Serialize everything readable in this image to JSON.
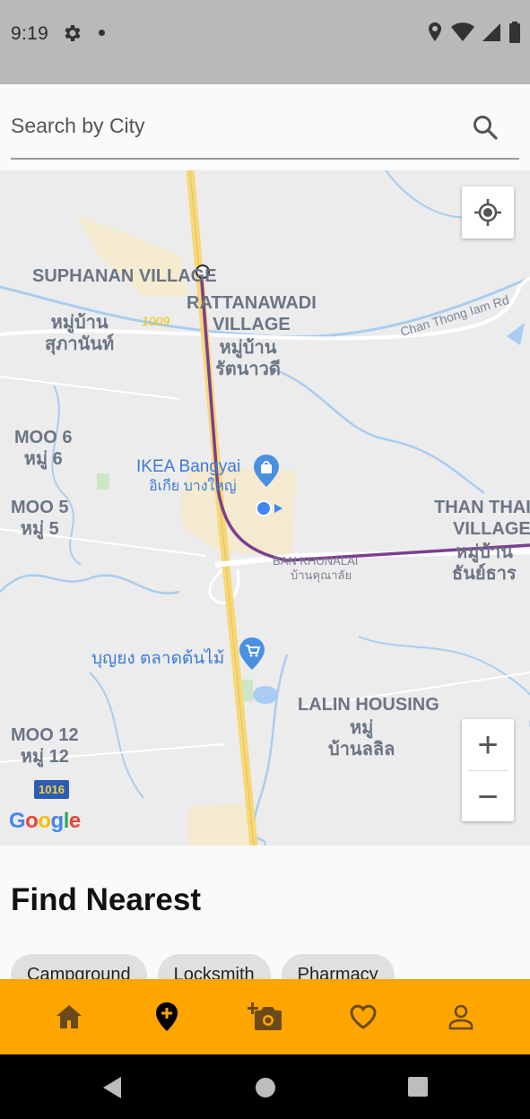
{
  "status_bar": {
    "time": "9:19",
    "icons": [
      "gear-icon",
      "dot-icon",
      "location-icon",
      "wifi-icon",
      "signal-icon",
      "battery-icon"
    ]
  },
  "search": {
    "placeholder": "Search by City",
    "icon": "search-icon"
  },
  "map": {
    "places": {
      "suphanan_en": "SUPHANAN\nVILLAGE",
      "suphanan_th": "หมู่บ้าน\nสุภานันท์",
      "rattanawadi_en": "RATTANAWADI\nVILLAGE",
      "rattanawadi_th": "หมู่บ้าน\nรัตนาวดี",
      "moo6": "MOO 6\nหมู่ 6",
      "moo5": "MOO 5\nหมู่ 5",
      "moo12": "MOO 12\nหมู่ 12",
      "ikea_en": "IKEA Bangyai",
      "ikea_th": "อิเกีย บางใหญ่",
      "than_thai_en": "THAN THAI\nVILLAGE",
      "than_thai_th": "หมู่บ้าน\nธันย์ธาร",
      "ban_khunalai_en": "BAN KHUNALAI",
      "ban_khunalai_th": "บ้านคุณาลัย",
      "market_th": "บุญยง ตลาดต้นไม้",
      "lalin_en": "LALIN HOUSING",
      "lalin_th": "หมู่\nบ้านลลิล",
      "road_name": "Chan Thong Iam Rd",
      "route_1009": "1009",
      "route_1016": "1016"
    },
    "attribution": "Google",
    "controls": {
      "locate_icon": "my-location-icon",
      "zoom_in": "+",
      "zoom_out": "−"
    }
  },
  "find_nearest": {
    "title": "Find Nearest",
    "chips": [
      "Campground",
      "Locksmith",
      "Pharmacy"
    ]
  },
  "bottom_nav": {
    "items": [
      "home-icon",
      "add-location-icon",
      "add-photo-icon",
      "favorite-icon",
      "profile-icon"
    ],
    "active_index": 1,
    "bg_color": "#ffa500"
  },
  "system_nav": {
    "items": [
      "back-icon",
      "home-circle-icon",
      "recents-icon"
    ]
  }
}
